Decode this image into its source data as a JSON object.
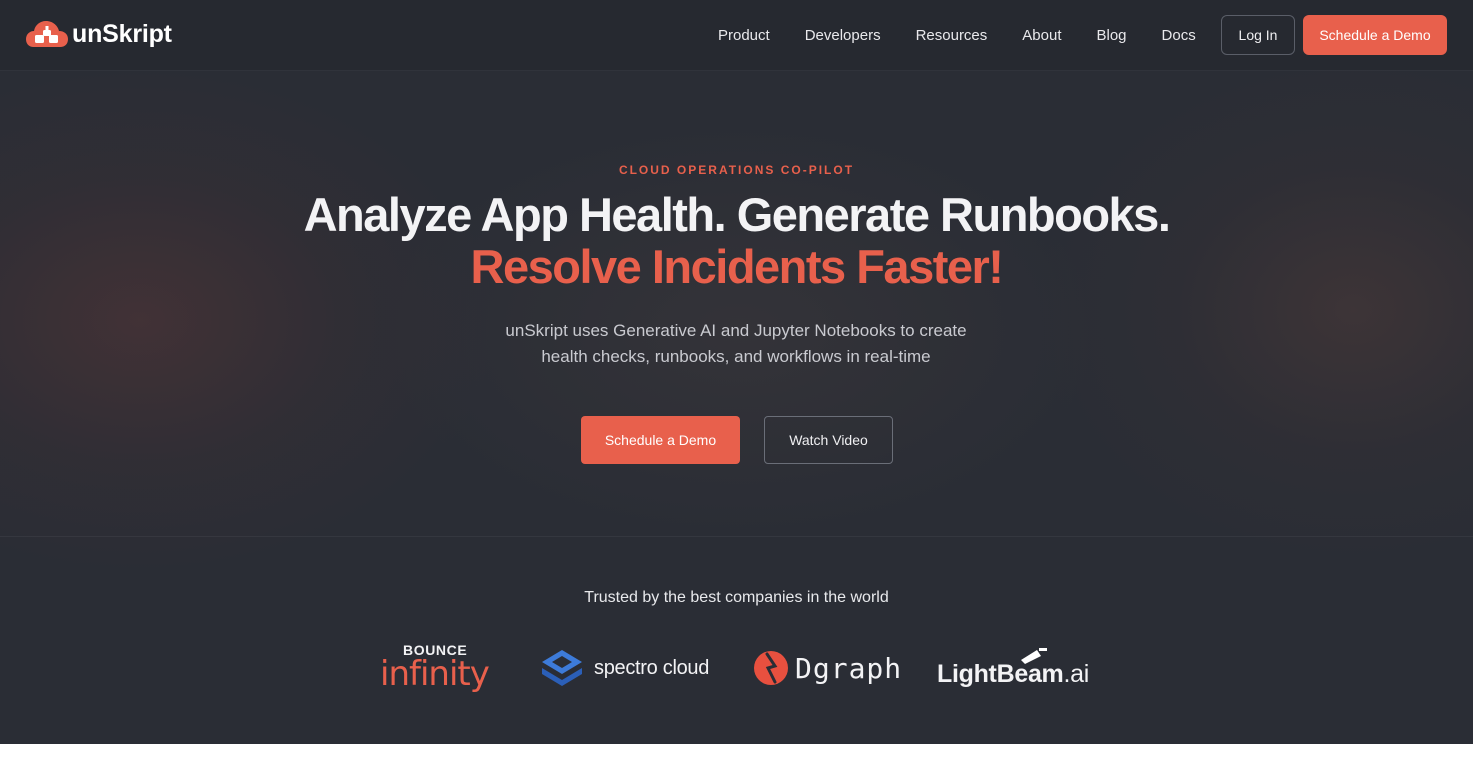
{
  "nav": {
    "brand": "unSkript",
    "links": [
      "Product",
      "Developers",
      "Resources",
      "About",
      "Blog",
      "Docs"
    ],
    "login_label": "Log In",
    "demo_label": "Schedule a Demo"
  },
  "hero": {
    "eyebrow": "CLOUD OPERATIONS CO-PILOT",
    "headline": "Analyze App Health. Generate Runbooks.",
    "headline_accent": "Resolve Incidents Faster!",
    "subtext": "unSkript uses Generative AI and Jupyter Notebooks to create health checks, runbooks, and workflows in real-time",
    "primary_cta": "Schedule a Demo",
    "secondary_cta": "Watch Video"
  },
  "trusted": {
    "title": "Trusted by the best companies in the world",
    "logos": {
      "bounce_top": "BOUNCE",
      "bounce_bottom": "infinity",
      "spectro": "spectro cloud",
      "dgraph": "Dgraph",
      "lightbeam_main": "LightBeam",
      "lightbeam_suffix": ".ai"
    }
  },
  "colors": {
    "accent": "#e8604c",
    "background": "#2a2d35",
    "navbar": "#262930",
    "spectro_blue": "#3d7bd9",
    "lightbeam_blue": "#6f7bff"
  }
}
